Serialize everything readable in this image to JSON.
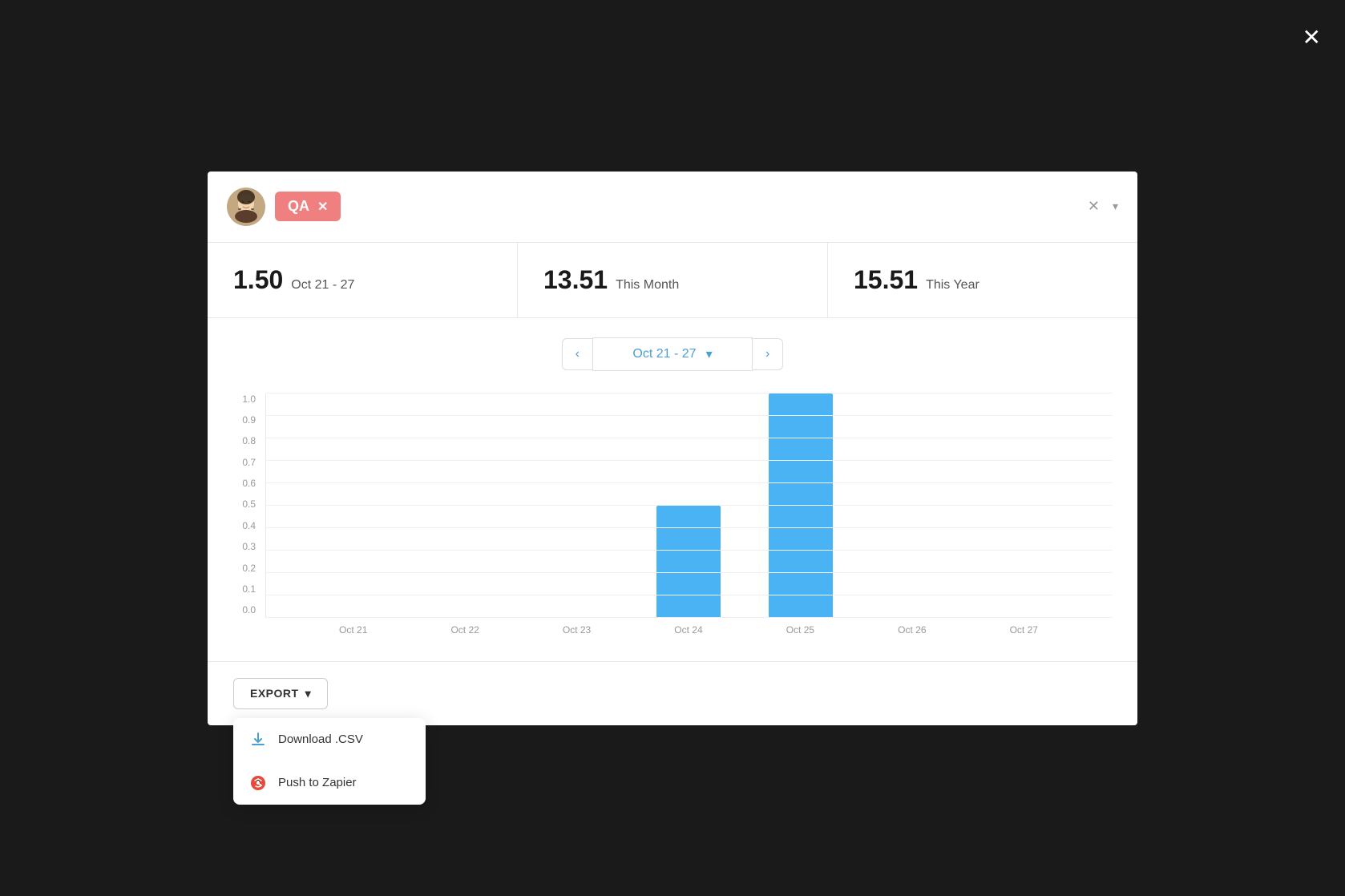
{
  "outer": {
    "close_label": "✕"
  },
  "header": {
    "badge_label": "QA",
    "badge_close": "✕",
    "close_btn": "✕",
    "dropdown_icon": "▾"
  },
  "stats": [
    {
      "number": "1.50",
      "label": "Oct 21 - 27"
    },
    {
      "number": "13.51",
      "label": "This Month"
    },
    {
      "number": "15.51",
      "label": "This Year"
    }
  ],
  "chart": {
    "nav_prev": "‹",
    "nav_next": "›",
    "date_range": "Oct 21 - 27",
    "chevron_label": "▾",
    "y_labels": [
      "1.0",
      "0.9",
      "0.8",
      "0.7",
      "0.6",
      "0.5",
      "0.4",
      "0.3",
      "0.2",
      "0.1",
      "0.0"
    ],
    "x_labels": [
      "Oct 21",
      "Oct 22",
      "Oct 23",
      "Oct 24",
      "Oct 25",
      "Oct 26",
      "Oct 27"
    ],
    "bars": [
      {
        "day": "Oct 21",
        "value": 0
      },
      {
        "day": "Oct 22",
        "value": 0
      },
      {
        "day": "Oct 23",
        "value": 0
      },
      {
        "day": "Oct 24",
        "value": 0.5
      },
      {
        "day": "Oct 25",
        "value": 1.0
      },
      {
        "day": "Oct 26",
        "value": 0
      },
      {
        "day": "Oct 27",
        "value": 0
      }
    ]
  },
  "export": {
    "button_label": "EXPORT",
    "dropdown": {
      "item1_label": "Download .CSV",
      "item2_label": "Push to Zapier"
    }
  }
}
